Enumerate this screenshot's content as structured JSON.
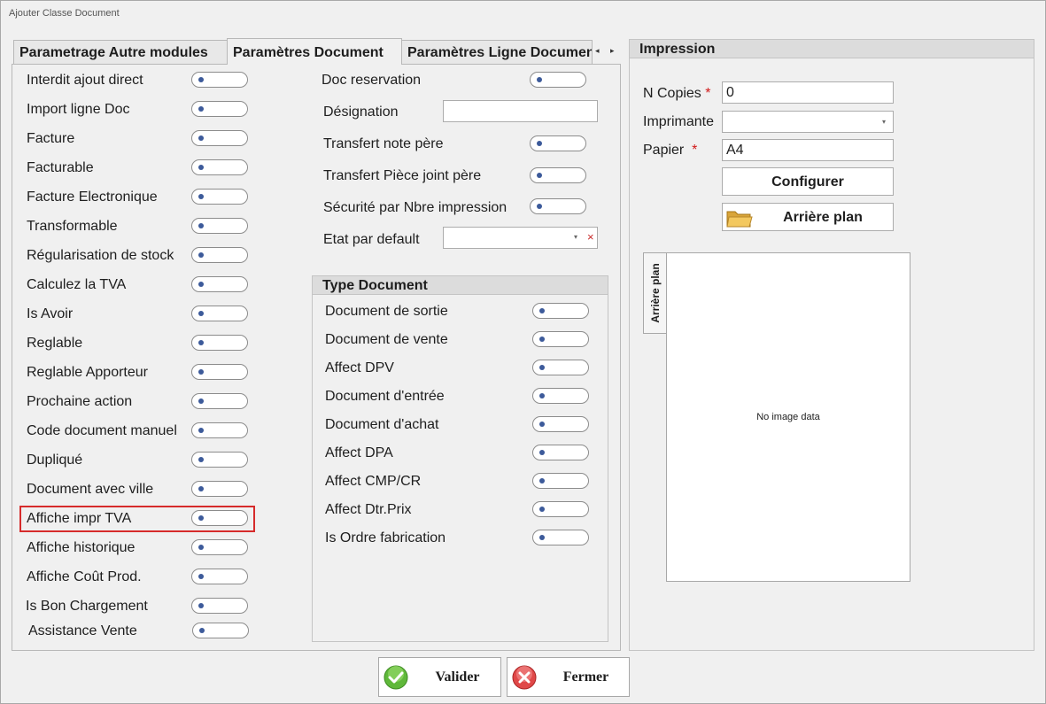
{
  "window": {
    "title": "Ajouter Classe Document"
  },
  "tabs": [
    {
      "label": "Parametrage Autre modules"
    },
    {
      "label": "Paramètres Document"
    },
    {
      "label": "Paramètres Ligne Document"
    }
  ],
  "tab_nav": {
    "prev": "◂",
    "next": "▸"
  },
  "left_toggles": [
    "Interdit ajout direct",
    "Import ligne Doc",
    "Facture",
    "Facturable",
    "Facture Electronique",
    "Transformable",
    "Régularisation de stock",
    "Calculez la TVA",
    "Is Avoir",
    "Reglable",
    "Reglable Apporteur",
    "Prochaine action",
    "Code document manuel",
    "Dupliqué",
    "Document avec ville",
    "Affiche impr TVA",
    "Affiche historique",
    "Affiche Coût Prod.",
    "Is Bon Chargement",
    "Assistance Vente"
  ],
  "middle": {
    "doc_reservation": "Doc reservation",
    "designation": "Désignation",
    "designation_value": "",
    "transfert_note": "Transfert note père",
    "transfert_piece": "Transfert Pièce joint père",
    "securite": "Sécurité par Nbre impression",
    "etat_default": "Etat par default",
    "etat_value": "",
    "combo_arrow": "▾",
    "clear_icon": "×"
  },
  "type_document": {
    "title": "Type Document",
    "items": [
      "Document de sortie",
      "Document de vente",
      "Affect DPV",
      "Document d'entrée",
      "Document d'achat",
      "Affect DPA",
      "Affect CMP/CR",
      "Affect Dtr.Prix",
      "Is Ordre fabrication"
    ]
  },
  "impression": {
    "title": "Impression",
    "n_copies_label": "N Copies",
    "n_copies_value": "0",
    "required_mark": "*",
    "imprimante_label": "Imprimante",
    "imprimante_value": "",
    "papier_label": "Papier",
    "papier_value": "A4",
    "configurer": "Configurer",
    "arriere_plan_btn": "Arrière plan",
    "arriere_plan_tab": "Arrière plan",
    "no_image": "No image data"
  },
  "footer": {
    "valider": "Valider",
    "fermer": "Fermer"
  },
  "colors": {
    "highlight": "#d62b2b",
    "required": "#d01818",
    "toggle_dot": "#3c5a9a"
  }
}
